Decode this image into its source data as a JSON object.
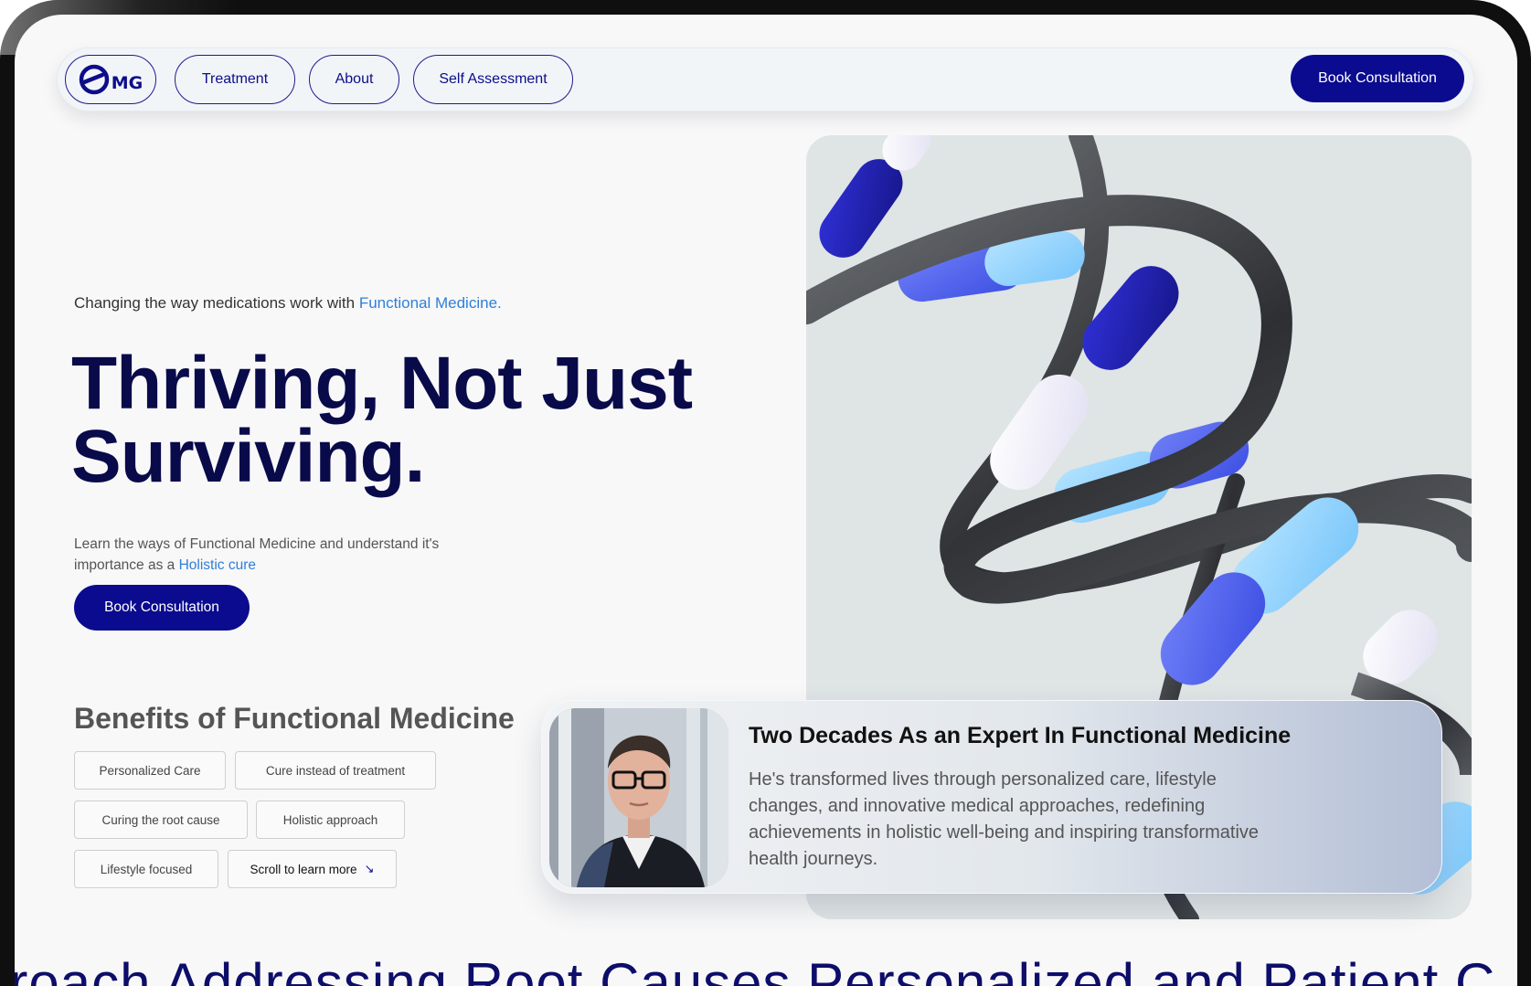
{
  "nav": {
    "logo_text": "MG",
    "items": [
      {
        "label": "Treatment"
      },
      {
        "label": "About"
      },
      {
        "label": "Self Assessment"
      }
    ],
    "cta_label": "Book Consultation"
  },
  "hero": {
    "tagline_prefix": "Changing the way medications work with ",
    "tagline_accent": "Functional Medicine.",
    "title_line1": "Thriving, Not Just",
    "title_line2": "Surviving.",
    "desc_prefix": "Learn the ways of Functional Medicine and understand it's importance as a ",
    "desc_accent": "Holistic cure",
    "cta_label": "Book Consultation"
  },
  "benefits": {
    "title": "Benefits of Functional Medicine",
    "chips": [
      "Personalized Care",
      "Cure instead of  treatment",
      "Curing the root cause",
      "Holistic approach",
      "Lifestyle focused"
    ],
    "scroll_label": "Scroll to learn more",
    "scroll_icon": "arrow-down-right-icon"
  },
  "expert": {
    "title": "Two Decades As an Expert In Functional Medicine",
    "body": "He's transformed lives through personalized care, lifestyle changes, and innovative medical approaches, redefining achievements in holistic well-being and inspiring transformative health journeys."
  },
  "marquee": {
    "text": "proach   Addressing Root Causes   Personalized and Patient C"
  },
  "colors": {
    "brand": "#0b0b8f",
    "heading": "#090a4a",
    "accent": "#2f7fd6",
    "background": "#f8f8f8"
  }
}
